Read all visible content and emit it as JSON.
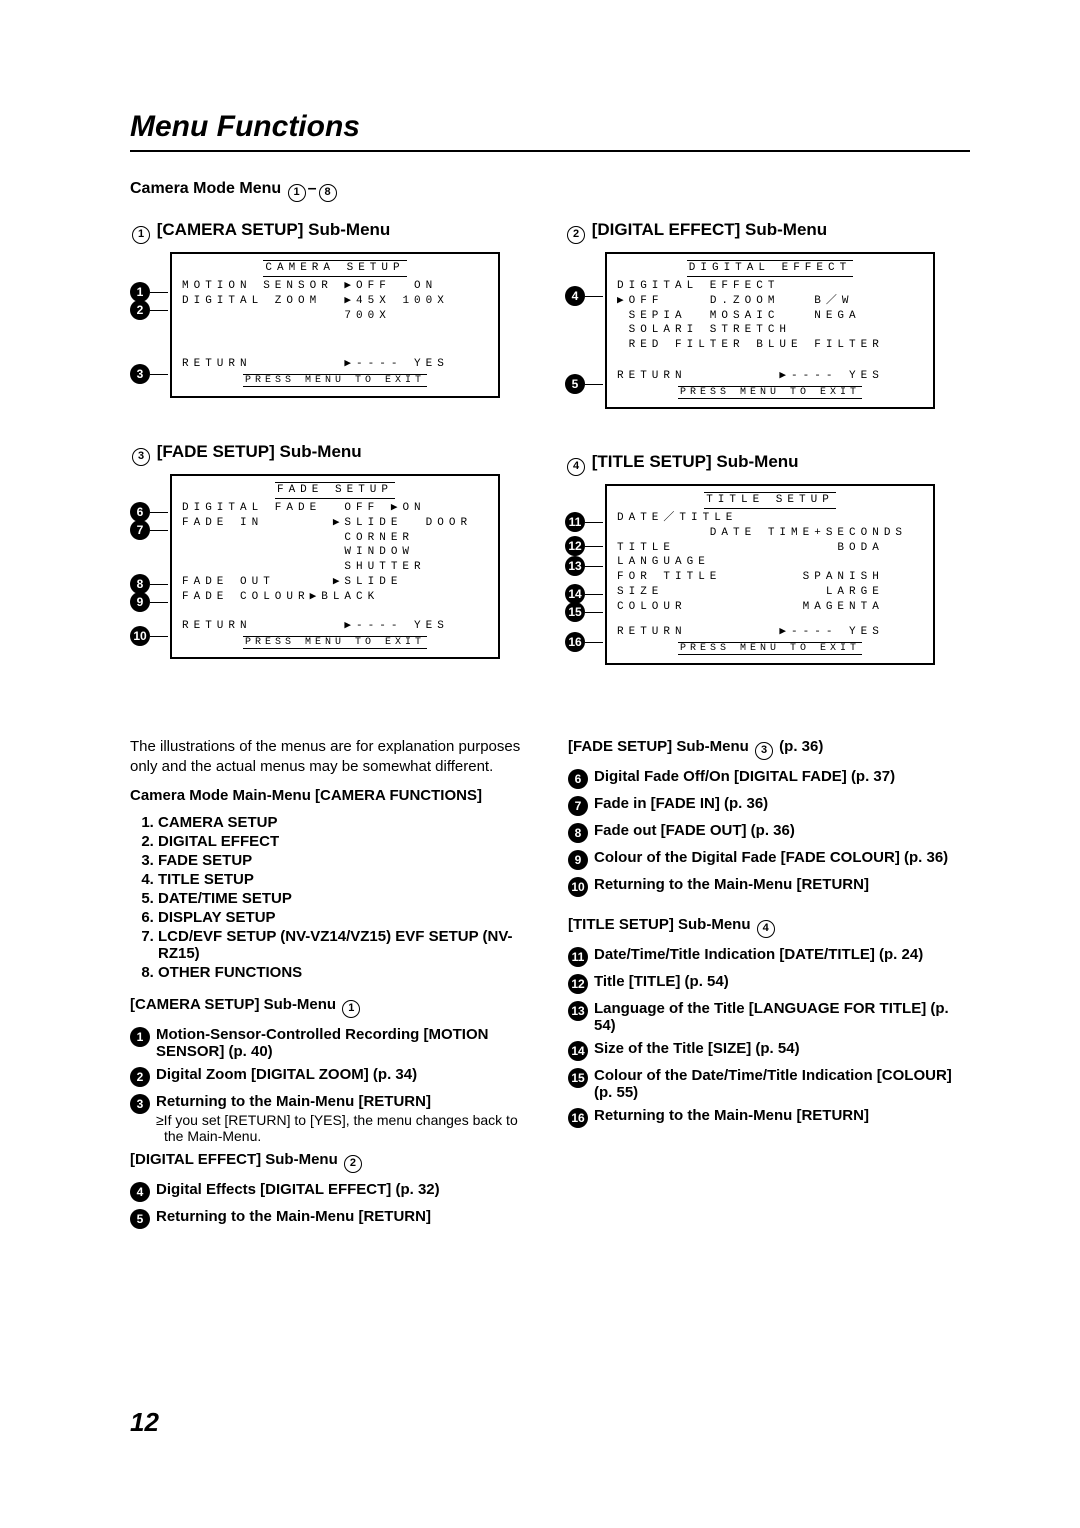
{
  "title": "Menu Functions",
  "mode_heading_prefix": "Camera Mode Menu ",
  "mode_heading_range_a": "1",
  "mode_heading_range_sep": "–",
  "mode_heading_range_b": "8",
  "screens": {
    "camera_setup": {
      "num": "1",
      "title": "[CAMERA SETUP] Sub-Menu",
      "header": "CAMERA SETUP",
      "callouts": [
        "1",
        "2",
        "3"
      ],
      "lines": [
        "MOTION SENSOR ▶OFF  ON",
        "DIGITAL ZOOM  ▶45X 100X",
        "              700X"
      ],
      "return": "RETURN        ▶---- YES",
      "exit": "PRESS MENU TO EXIT"
    },
    "digital_effect": {
      "num": "2",
      "title": "[DIGITAL EFFECT] Sub-Menu",
      "header": "DIGITAL EFFECT",
      "callouts": [
        "4",
        "5"
      ],
      "lines": [
        "DIGITAL EFFECT",
        "▶OFF    D.ZOOM   B／W",
        " SEPIA  MOSAIC   NEGA",
        " SOLARI STRETCH",
        " RED FILTER BLUE FILTER"
      ],
      "return": "RETURN        ▶---- YES",
      "exit": "PRESS MENU TO EXIT"
    },
    "fade_setup": {
      "num": "3",
      "title": "[FADE SETUP] Sub-Menu",
      "header": "FADE SETUP",
      "callouts": [
        "6",
        "7",
        "8",
        "9",
        "10"
      ],
      "lines": [
        "DIGITAL FADE  OFF ▶ON",
        "FADE IN      ▶SLIDE  DOOR",
        "              CORNER",
        "              WINDOW",
        "              SHUTTER",
        "FADE OUT     ▶SLIDE",
        "FADE COLOUR▶BLACK"
      ],
      "return": "RETURN        ▶---- YES",
      "exit": "PRESS MENU TO EXIT"
    },
    "title_setup": {
      "num": "4",
      "title": "[TITLE SETUP] Sub-Menu",
      "header": "TITLE SETUP",
      "callouts": [
        "11",
        "12",
        "13",
        "14",
        "15",
        "16"
      ],
      "lines": [
        "DATE／TITLE",
        "        DATE TIME+SECONDS",
        "TITLE              BODA",
        "LANGUAGE",
        "FOR TITLE       SPANISH",
        "SIZE              LARGE",
        "COLOUR          MAGENTA"
      ],
      "return": "RETURN        ▶---- YES",
      "exit": "PRESS MENU TO EXIT"
    }
  },
  "left_col": {
    "intro": "The illustrations of the menus are for explanation purposes only and the actual menus may be somewhat different.",
    "mainmenu_heading": "Camera Mode Main-Menu [CAMERA FUNCTIONS]",
    "mainmenu": [
      "CAMERA SETUP",
      "DIGITAL EFFECT",
      "FADE SETUP",
      "TITLE SETUP",
      "DATE/TIME SETUP",
      "DISPLAY SETUP",
      "LCD/EVF SETUP (NV-VZ14/VZ15) EVF SETUP (NV-RZ15)",
      "OTHER FUNCTIONS"
    ],
    "sub1_heading": "[CAMERA SETUP] Sub-Menu ",
    "sub1_num": "1",
    "e1": "Motion-Sensor-Controlled Recording [MOTION SENSOR] (p. 40)",
    "e2": "Digital Zoom [DIGITAL ZOOM] (p. 34)",
    "e3": "Returning to the Main-Menu [RETURN]",
    "e3_sub": "≥If you set [RETURN] to [YES], the menu changes back to the Main-Menu.",
    "sub2_heading": "[DIGITAL EFFECT] Sub-Menu ",
    "sub2_num": "2",
    "e4": "Digital Effects [DIGITAL EFFECT] (p. 32)",
    "e5": "Returning to the Main-Menu [RETURN]"
  },
  "right_col": {
    "sub3_heading": "[FADE SETUP] Sub-Menu ",
    "sub3_num": "3",
    "sub3_page": "  (p. 36)",
    "e6": "Digital Fade Off/On [DIGITAL FADE] (p. 37)",
    "e7": "Fade in [FADE IN] (p. 36)",
    "e8": "Fade out [FADE OUT] (p. 36)",
    "e9": "Colour of the Digital Fade [FADE COLOUR] (p. 36)",
    "e10": "Returning to the Main-Menu [RETURN]",
    "sub4_heading": "[TITLE SETUP] Sub-Menu ",
    "sub4_num": "4",
    "e11": "Date/Time/Title Indication [DATE/TITLE] (p. 24)",
    "e12": "Title [TITLE] (p. 54)",
    "e13": "Language of the Title [LANGUAGE FOR TITLE] (p. 54)",
    "e14": "Size of the Title [SIZE] (p. 54)",
    "e15": "Colour of the Date/Time/Title Indication [COLOUR] (p. 55)",
    "e16": "Returning to the Main-Menu [RETURN]"
  },
  "page_number": "12"
}
